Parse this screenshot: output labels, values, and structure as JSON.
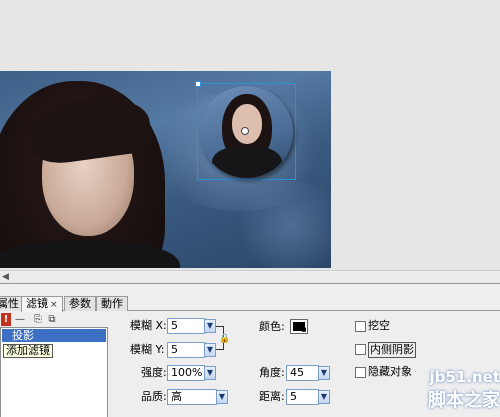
{
  "tabs": [
    {
      "label": "属性"
    },
    {
      "label": "滤镜",
      "close": "×"
    },
    {
      "label": "参数"
    },
    {
      "label": "動作"
    }
  ],
  "filter_toolbar": {
    "warn": "!",
    "remove": "—",
    "copy": "⎘",
    "paste": "⧉"
  },
  "filters": {
    "selected_item": "投影",
    "tooltip": "添加滤镜"
  },
  "props": {
    "blur_x_label": "模糊 X:",
    "blur_x_value": "5",
    "blur_y_label": "模糊 Y:",
    "blur_y_value": "5",
    "strength_label": "强度:",
    "strength_value": "100%",
    "quality_label": "品质:",
    "quality_value": "高",
    "color_label": "颜色:",
    "color_value": "#000000",
    "angle_label": "角度:",
    "angle_value": "45",
    "distance_label": "距离:",
    "distance_value": "5",
    "knockout_label": "挖空",
    "inner_shadow_label": "内侧阴影",
    "hide_object_label": "隐藏对象"
  },
  "watermark": {
    "url": "jb51.net",
    "brand": "脚本之家"
  },
  "colors": {
    "selection": "#3d6fc2",
    "bounding_box": "#2f8fd6",
    "warn": "#c8301e"
  }
}
